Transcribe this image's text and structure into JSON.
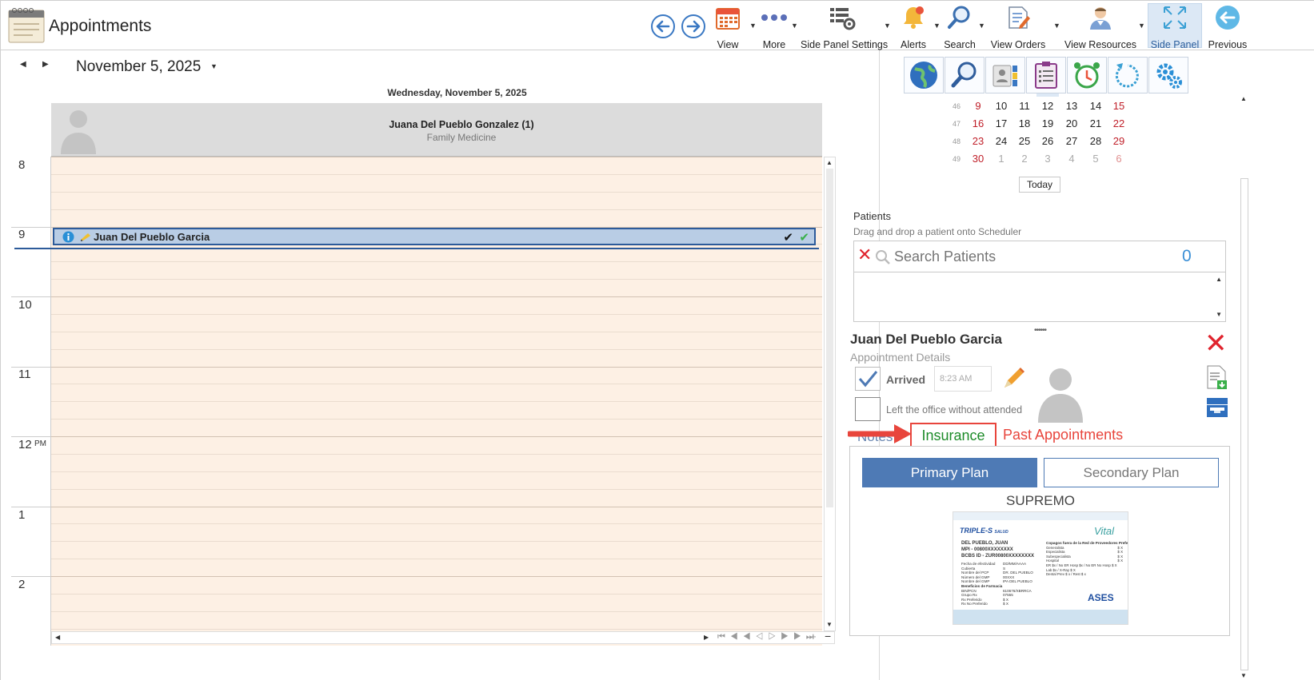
{
  "window": {
    "title": "Appointments"
  },
  "toolbar": {
    "buttons": [
      {
        "id": "view",
        "label": "View"
      },
      {
        "id": "more",
        "label": "More"
      },
      {
        "id": "side_panel_settings",
        "label": "Side Panel Settings"
      },
      {
        "id": "alerts",
        "label": "Alerts"
      },
      {
        "id": "search",
        "label": "Search"
      },
      {
        "id": "view_orders",
        "label": "View Orders"
      },
      {
        "id": "view_resources",
        "label": "View Resources"
      },
      {
        "id": "side_panel",
        "label": "Side Panel"
      },
      {
        "id": "previous",
        "label": "Previous"
      }
    ]
  },
  "scheduler": {
    "date_selector": "November 5, 2025",
    "day_header": "Wednesday, November 5, 2025",
    "resource": {
      "name": "Juana Del Pueblo Gonzalez (1)",
      "specialty": "Family Medicine"
    },
    "hours": [
      "8",
      "9",
      "10",
      "11",
      "12",
      "1",
      "2"
    ],
    "pm_label": "PM",
    "appointment": {
      "patient": "Juan Del Pueblo Garcia",
      "status_icons": [
        "checkmark",
        "green-checkmark"
      ]
    }
  },
  "mini_calendar": {
    "weeks": [
      {
        "num": "46",
        "days": [
          "9",
          "10",
          "11",
          "12",
          "13",
          "14",
          "15"
        ]
      },
      {
        "num": "47",
        "days": [
          "16",
          "17",
          "18",
          "19",
          "20",
          "21",
          "22"
        ]
      },
      {
        "num": "48",
        "days": [
          "23",
          "24",
          "25",
          "26",
          "27",
          "28",
          "29"
        ]
      },
      {
        "num": "49",
        "days": [
          "30",
          "1",
          "2",
          "3",
          "4",
          "5",
          "6"
        ]
      }
    ],
    "today_button": "Today"
  },
  "patients": {
    "title": "Patients",
    "subtitle": "Drag and drop a patient onto Scheduler",
    "search_placeholder": "Search Patients",
    "count": "0"
  },
  "appointment_details": {
    "patient_name": "Juan Del Pueblo Garcia",
    "subtitle": "Appointment Details",
    "arrived_label": "Arrived",
    "arrived_time": "8:23 AM",
    "arrived_checked": true,
    "left_office_label": "Left the office without attended",
    "left_office_checked": false,
    "tabs": {
      "notes": "Notes",
      "insurance": "Insurance",
      "past": "Past Appointments"
    },
    "plans": {
      "primary": "Primary Plan",
      "secondary": "Secondary Plan"
    },
    "plan_name": "SUPREMO"
  },
  "insurance_card": {
    "brand": "TRIPLE-S",
    "brand_suffix": "SALUD",
    "vital": "Vital",
    "member_name": "DEL PUEBLO, JUAN",
    "mpi": "MPI - 00800XXXXXXXX",
    "bcbs": "BCBS ID - ZUR00800XXXXXXXX",
    "rows": [
      [
        "Fecha de efectividad",
        "DD/MM/AAAA"
      ],
      [
        "Cubierta",
        "S"
      ],
      [
        "Nombre del PCP",
        "DR. DEL PUEBLO"
      ],
      [
        "Número del GMP",
        "00XXX"
      ],
      [
        "Nombre del GMP",
        "IPA DEL PUEBLO"
      ]
    ],
    "pharmacy_title": "Beneficios de Farmacia",
    "pharmacy_rows": [
      [
        "BIN/PCN",
        "610676/XBRRCA"
      ],
      [
        "Grupo Rx",
        "07555"
      ],
      [
        "Rx Preferido",
        "$ X"
      ],
      [
        "Rx No Preferido",
        "$ X"
      ]
    ],
    "copay_title": "Copagos fuera de la Red de Proveedores Preferida",
    "copay_rows": [
      [
        "Generalista",
        "$ X"
      ],
      [
        "Especialista",
        "$ X"
      ],
      [
        "Subespecialista",
        "$ X"
      ],
      [
        "Hospital",
        "$ X"
      ],
      [
        "ER $x / No ER Hosp $x / No ER No Hosp $ X",
        ""
      ],
      [
        "Lab $x / X-Ray $ X",
        ""
      ],
      [
        "Dental Prev $ x / Rest $ x",
        ""
      ]
    ],
    "ases": "ASES"
  },
  "colors": {
    "accent": "#4e7ab5",
    "appointment_bg": "#b9cde5",
    "scheduler_bg": "#fdf0e4",
    "annotation_red": "#e8453c",
    "insurance_green": "#1e8c2a"
  }
}
